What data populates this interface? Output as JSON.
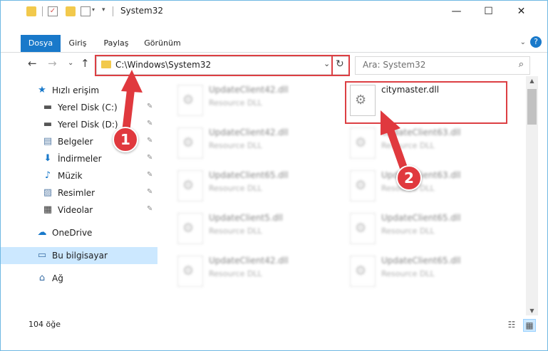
{
  "window": {
    "title": "System32",
    "minimize": "—",
    "maximize": "☐",
    "close": "✕"
  },
  "ribbon": {
    "tabs": [
      "Dosya",
      "Giriş",
      "Paylaş",
      "Görünüm"
    ],
    "expand": "⌄",
    "help": "?"
  },
  "nav": {
    "back": "←",
    "forward": "→",
    "recent": "⌄",
    "up": "↑"
  },
  "address": {
    "path": "C:\\Windows\\System32",
    "dropdown": "⌄",
    "refresh": "↻"
  },
  "search": {
    "placeholder": "Ara: System32",
    "icon": "⌕"
  },
  "sidebar": {
    "items": [
      {
        "label": "Hızlı erişim",
        "icon": "★",
        "color": "#1979ca",
        "pinned": false
      },
      {
        "label": "Yerel Disk (C:)",
        "icon": "▬",
        "color": "#555555",
        "pinned": true
      },
      {
        "label": "Yerel Disk (D:)",
        "icon": "▬",
        "color": "#555555",
        "pinned": true
      },
      {
        "label": "Belgeler",
        "icon": "▤",
        "color": "#5a7fa8",
        "pinned": true
      },
      {
        "label": "İndirmeler",
        "icon": "⬇",
        "color": "#1979ca",
        "pinned": true
      },
      {
        "label": "Müzik",
        "icon": "♪",
        "color": "#1979ca",
        "pinned": true
      },
      {
        "label": "Resimler",
        "icon": "▨",
        "color": "#5a7fa8",
        "pinned": true
      },
      {
        "label": "Videolar",
        "icon": "▦",
        "color": "#333333",
        "pinned": true
      },
      {
        "label": "OneDrive",
        "icon": "☁",
        "color": "#1979ca",
        "pinned": false
      },
      {
        "label": "Bu bilgisayar",
        "icon": "▭",
        "color": "#3a6ea5",
        "pinned": false,
        "selected": true
      },
      {
        "label": "Ağ",
        "icon": "⌂",
        "color": "#3a6ea5",
        "pinned": false
      }
    ],
    "pin_icon": "📌"
  },
  "files": [
    {
      "name": "UpdateClient42.dll",
      "type": "Resource DLL",
      "blurred": true
    },
    {
      "name": "citymaster.dll",
      "type": "",
      "blurred": false,
      "highlighted": true
    },
    {
      "name": "UpdateClient42.dll",
      "type": "Resource DLL",
      "blurred": true
    },
    {
      "name": "UpdateClient63.dll",
      "type": "Resource DLL",
      "blurred": true
    },
    {
      "name": "UpdateClient65.dll",
      "type": "Resource DLL",
      "blurred": true
    },
    {
      "name": "UpdateClient63.dll",
      "type": "Resource DLL",
      "blurred": true
    },
    {
      "name": "UpdateClient5.dll",
      "type": "Resource DLL",
      "blurred": true
    },
    {
      "name": "UpdateClient65.dll",
      "type": "Resource DLL",
      "blurred": true
    },
    {
      "name": "UpdateClient42.dll",
      "type": "Resource DLL",
      "blurred": true
    },
    {
      "name": "UpdateClient65.dll",
      "type": "Resource DLL",
      "blurred": true
    }
  ],
  "status": {
    "count": "104 öğe"
  },
  "annotations": {
    "step1": "1",
    "step2": "2"
  },
  "colors": {
    "accent": "#1979ca",
    "annotation": "#e0393e",
    "selection": "#cce8ff"
  }
}
